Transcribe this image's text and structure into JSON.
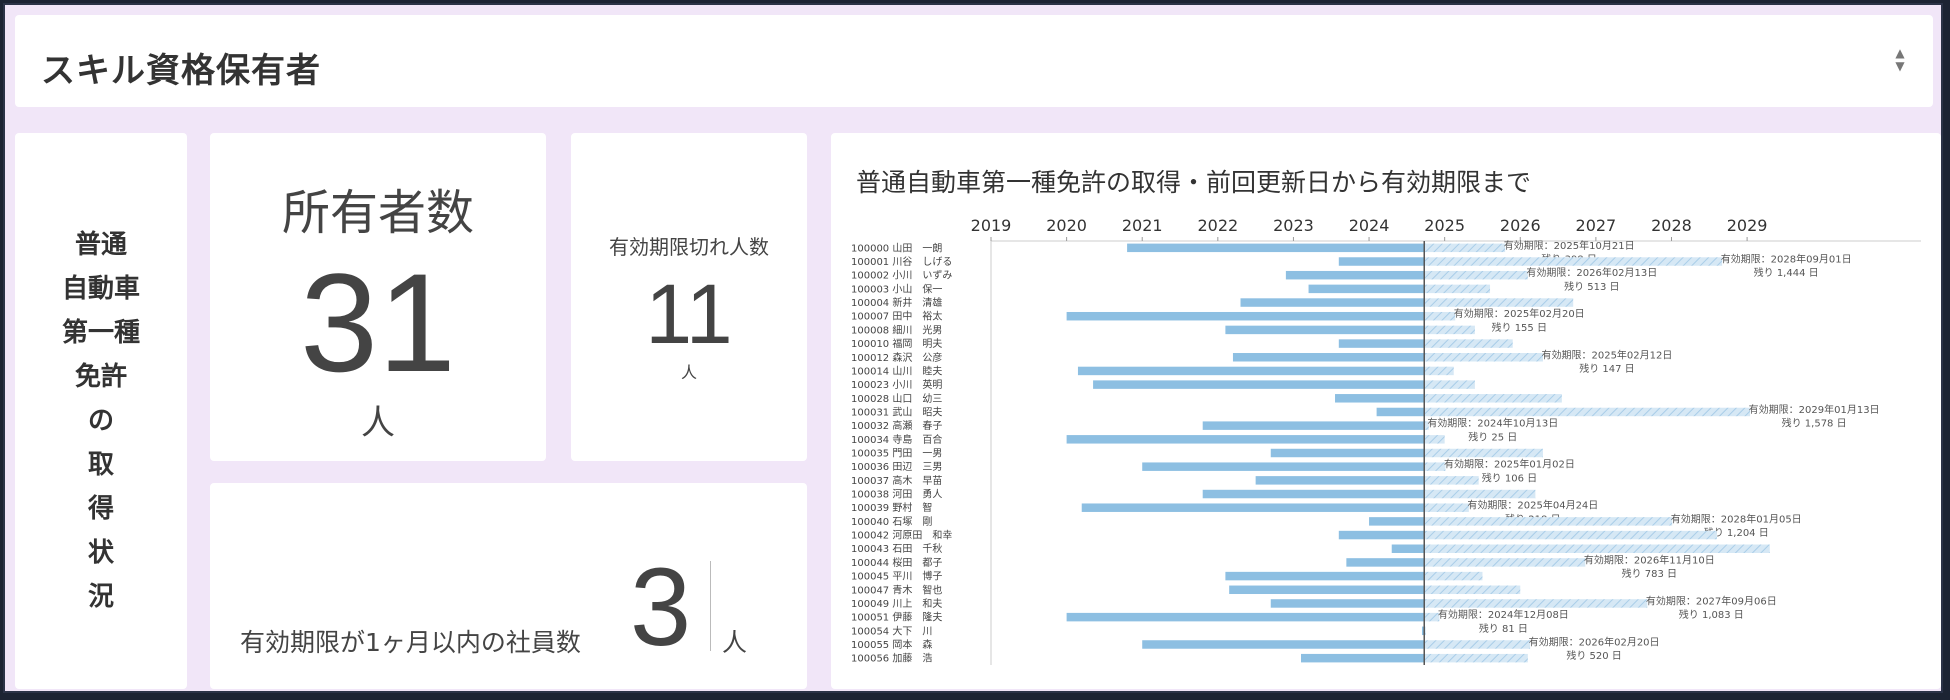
{
  "header": {
    "title": "スキル資格保有者"
  },
  "side": {
    "label": "普通自動車第一種免許の取得状況",
    "lines": [
      "普通",
      "自動車",
      "第一種",
      "免許",
      "の",
      "取",
      "得",
      "状",
      "況"
    ]
  },
  "owners": {
    "label": "所有者数",
    "value": "31",
    "unit": "人"
  },
  "expired": {
    "label": "有効期限切れ人数",
    "value": "11",
    "unit": "人"
  },
  "soon": {
    "label": "有効期限が1ヶ月以内の社員数",
    "value": "3",
    "unit": "人"
  },
  "chart_title": "普通自動車第一種免許の取得・前回更新日から有効期限まで",
  "chart_data": {
    "type": "bar",
    "orientation": "horizontal-gantt",
    "title": "普通自動車第一種免許の取得・前回更新日から有効期限まで",
    "x_ticks": [
      "2019",
      "2020",
      "2021",
      "2022",
      "2023",
      "2024",
      "2025",
      "2026",
      "2027",
      "2028",
      "2029"
    ],
    "xlim": [
      2019.0,
      2031.3
    ],
    "today": 2024.73,
    "grid": false,
    "colors": {
      "bar": "#8dbfe2",
      "remaining": "#c9e0f1",
      "today_line": "#555555"
    },
    "rows": [
      {
        "id": "100000",
        "name": "山田　一朗",
        "start": 2020.8,
        "end": 2025.8,
        "label": "有効期限：2025年10月21日",
        "remain": "残り 398 日"
      },
      {
        "id": "100001",
        "name": "川谷　しげる",
        "start": 2023.6,
        "end": 2028.67,
        "label": "有効期限：2028年09月01日",
        "remain": "残り 1,444 日"
      },
      {
        "id": "100002",
        "name": "小川　いずみ",
        "start": 2022.9,
        "end": 2026.1,
        "label": "有効期限：2026年02月13日",
        "remain": "残り 513 日"
      },
      {
        "id": "100003",
        "name": "小山　保一",
        "start": 2023.2,
        "end": 2025.6,
        "label": "",
        "remain": ""
      },
      {
        "id": "100004",
        "name": "新井　清雄",
        "start": 2022.3,
        "end": 2026.7,
        "label": "",
        "remain": ""
      },
      {
        "id": "100007",
        "name": "田中　裕太",
        "start": 2020.0,
        "end": 2025.14,
        "label": "有効期限：2025年02月20日",
        "remain": "残り 155 日"
      },
      {
        "id": "100008",
        "name": "細川　光男",
        "start": 2022.1,
        "end": 2025.4,
        "label": "",
        "remain": ""
      },
      {
        "id": "100010",
        "name": "福岡　明夫",
        "start": 2023.6,
        "end": 2025.9,
        "label": "",
        "remain": ""
      },
      {
        "id": "100012",
        "name": "森沢　公彦",
        "start": 2022.2,
        "end": 2026.3,
        "label": "有効期限：2025年02月12日",
        "remain": "残り 147 日"
      },
      {
        "id": "100014",
        "name": "山川　睦夫",
        "start": 2020.15,
        "end": 2025.12,
        "label": "",
        "remain": ""
      },
      {
        "id": "100023",
        "name": "小川　英明",
        "start": 2020.35,
        "end": 2025.4,
        "label": "",
        "remain": ""
      },
      {
        "id": "100028",
        "name": "山口　幼三",
        "start": 2023.55,
        "end": 2026.55,
        "label": "",
        "remain": ""
      },
      {
        "id": "100031",
        "name": "武山　昭夫",
        "start": 2024.1,
        "end": 2029.04,
        "label": "有効期限：2029年01月13日",
        "remain": "残り 1,578 日"
      },
      {
        "id": "100032",
        "name": "高瀬　春子",
        "start": 2021.8,
        "end": 2024.79,
        "label": "有効期限：2024年10月13日",
        "remain": "残り 25 日"
      },
      {
        "id": "100034",
        "name": "寺島　百合",
        "start": 2020.0,
        "end": 2025.0,
        "label": "",
        "remain": ""
      },
      {
        "id": "100035",
        "name": "門田　一男",
        "start": 2022.7,
        "end": 2026.3,
        "label": "",
        "remain": ""
      },
      {
        "id": "100036",
        "name": "田辺　三男",
        "start": 2021.0,
        "end": 2025.01,
        "label": "有効期限：2025年01月02日",
        "remain": "残り 106 日"
      },
      {
        "id": "100037",
        "name": "高木　早苗",
        "start": 2022.5,
        "end": 2025.45,
        "label": "",
        "remain": ""
      },
      {
        "id": "100038",
        "name": "河田　勇人",
        "start": 2021.8,
        "end": 2026.2,
        "label": "",
        "remain": ""
      },
      {
        "id": "100039",
        "name": "野村　智",
        "start": 2020.2,
        "end": 2025.32,
        "label": "有効期限：2025年04月24日",
        "remain": "残り 218 日"
      },
      {
        "id": "100040",
        "name": "石塚　剛",
        "start": 2024.0,
        "end": 2028.01,
        "label": "有効期限：2028年01月05日",
        "remain": "残り 1,204 日"
      },
      {
        "id": "100042",
        "name": "河原田　和幸",
        "start": 2023.6,
        "end": 2028.6,
        "label": "",
        "remain": ""
      },
      {
        "id": "100043",
        "name": "石田　千秋",
        "start": 2024.3,
        "end": 2029.3,
        "label": "",
        "remain": ""
      },
      {
        "id": "100044",
        "name": "桜田　都子",
        "start": 2023.7,
        "end": 2026.86,
        "label": "有効期限：2026年11月10日",
        "remain": "残り 783 日"
      },
      {
        "id": "100045",
        "name": "平川　博子",
        "start": 2022.1,
        "end": 2025.5,
        "label": "",
        "remain": ""
      },
      {
        "id": "100047",
        "name": "青木　智也",
        "start": 2022.15,
        "end": 2026.0,
        "label": "",
        "remain": ""
      },
      {
        "id": "100049",
        "name": "川上　和夫",
        "start": 2022.7,
        "end": 2027.68,
        "label": "有効期限：2027年09月06日",
        "remain": "残り 1,083 日"
      },
      {
        "id": "100051",
        "name": "伊藤　隆夫",
        "start": 2020.0,
        "end": 2024.93,
        "label": "有効期限：2024年12月08日",
        "remain": "残り 81 日"
      },
      {
        "id": "100054",
        "name": "大下　川",
        "start": 2024.7,
        "end": 2024.75,
        "label": "",
        "remain": ""
      },
      {
        "id": "100055",
        "name": "岡本　森",
        "start": 2021.0,
        "end": 2026.13,
        "label": "有効期限：2026年02月20日",
        "remain": "残り 520 日"
      },
      {
        "id": "100056",
        "name": "加藤　浩",
        "start": 2023.1,
        "end": 2026.1,
        "label": "",
        "remain": ""
      }
    ]
  }
}
